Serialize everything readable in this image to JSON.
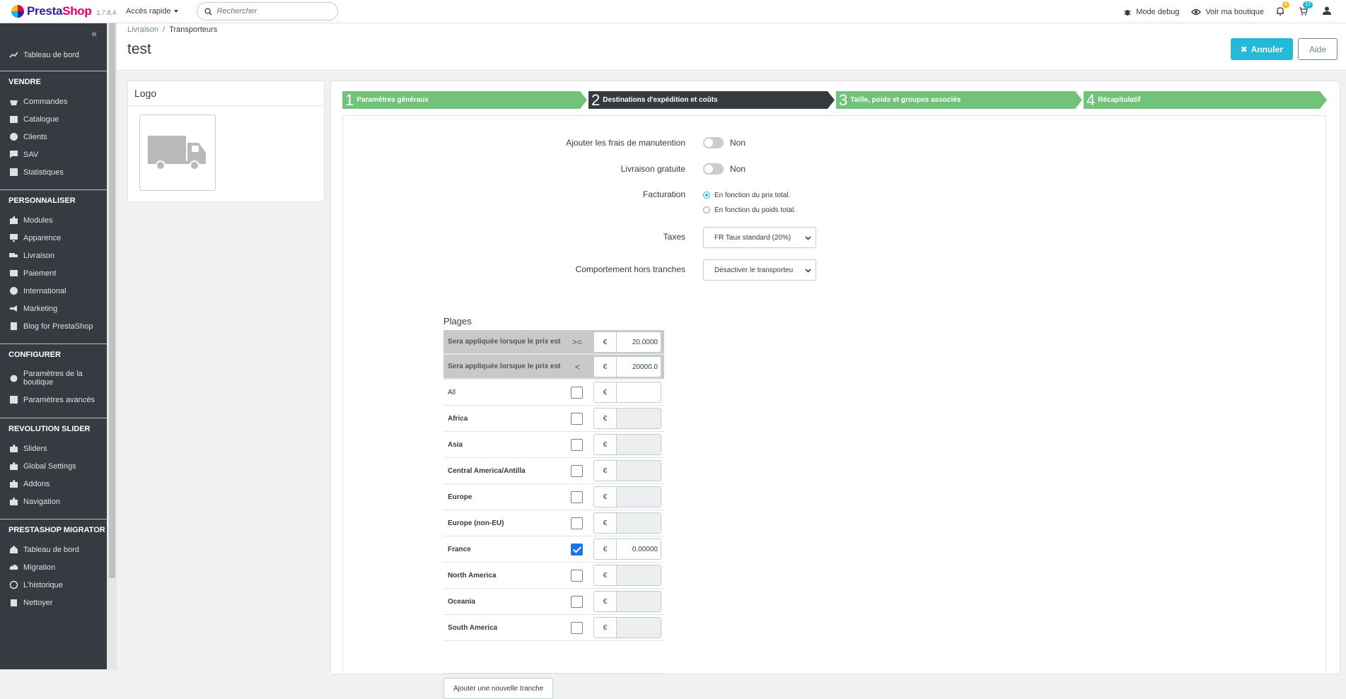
{
  "header": {
    "brand_a": "Presta",
    "brand_b": "Shop",
    "version": "1.7.8.4",
    "quick_access": "Accès rapide",
    "search_placeholder": "Rechercher",
    "debug": "Mode debug",
    "view_shop": "Voir ma boutique",
    "notif_count": "8",
    "orders_count": "17"
  },
  "sidebar": {
    "dashboard": "Tableau de bord",
    "sections": [
      {
        "title": "VENDRE",
        "items": [
          "Commandes",
          "Catalogue",
          "Clients",
          "SAV",
          "Statistiques"
        ]
      },
      {
        "title": "PERSONNALISER",
        "items": [
          "Modules",
          "Apparence",
          "Livraison",
          "Paiement",
          "International",
          "Marketing",
          "Blog for PrestaShop"
        ]
      },
      {
        "title": "CONFIGURER",
        "items": [
          "Paramètres de la boutique",
          "Paramètres avancés"
        ]
      },
      {
        "title": "REVOLUTION SLIDER",
        "items": [
          "Sliders",
          "Global Settings",
          "Addons",
          "Navigation"
        ]
      },
      {
        "title": "PRESTASHOP MIGRATOR",
        "items": [
          "Tableau de bord",
          "Migration",
          "L'historique",
          "Nettoyer"
        ]
      }
    ]
  },
  "page": {
    "breadcrumb_1": "Livraison",
    "breadcrumb_2": "Transporteurs",
    "title": "test",
    "cancel": "Annuler",
    "help": "Aide",
    "logo_panel_title": "Logo"
  },
  "wizard": {
    "steps": [
      {
        "num": "1",
        "label": "Paramètres généraux"
      },
      {
        "num": "2",
        "label": "Destinations d'expédition et coûts"
      },
      {
        "num": "3",
        "label": "Taille, poids et groupes associés"
      },
      {
        "num": "4",
        "label": "Récapitulatif"
      }
    ],
    "active_step": 2
  },
  "form": {
    "handling_label": "Ajouter les frais de manutention",
    "handling_value": "Non",
    "free_label": "Livraison gratuite",
    "free_value": "Non",
    "billing_label": "Facturation",
    "billing_opt1": "En fonction du prix total.",
    "billing_opt2": "En fonction du poids total.",
    "taxes_label": "Taxes",
    "taxes_value": "FR Taux standard (20%)",
    "out_label": "Comportement hors tranches",
    "out_value": "Désactiver le transporteu",
    "ranges_title": "Plages",
    "range_ge_label": "Sera appliquée lorsque le prix est",
    "range_ge_op": ">=",
    "range_ge_value": "20.0000",
    "range_lt_label": "Sera appliquée lorsque le prix est",
    "range_lt_op": "<",
    "range_lt_value": "20000.0",
    "currency": "€",
    "add_range": "Ajouter une nouvelle tranche",
    "zones": [
      {
        "name": "All",
        "checked": false,
        "value": "",
        "disabled": false
      },
      {
        "name": "Africa",
        "checked": false,
        "value": "",
        "disabled": true
      },
      {
        "name": "Asia",
        "checked": false,
        "value": "",
        "disabled": true
      },
      {
        "name": "Central America/Antilla",
        "checked": false,
        "value": "",
        "disabled": true
      },
      {
        "name": "Europe",
        "checked": false,
        "value": "",
        "disabled": true
      },
      {
        "name": "Europe (non-EU)",
        "checked": false,
        "value": "",
        "disabled": true
      },
      {
        "name": "France",
        "checked": true,
        "value": "0.00000",
        "disabled": false
      },
      {
        "name": "North America",
        "checked": false,
        "value": "",
        "disabled": true
      },
      {
        "name": "Oceania",
        "checked": false,
        "value": "",
        "disabled": true
      },
      {
        "name": "South America",
        "checked": false,
        "value": "",
        "disabled": true
      }
    ]
  }
}
